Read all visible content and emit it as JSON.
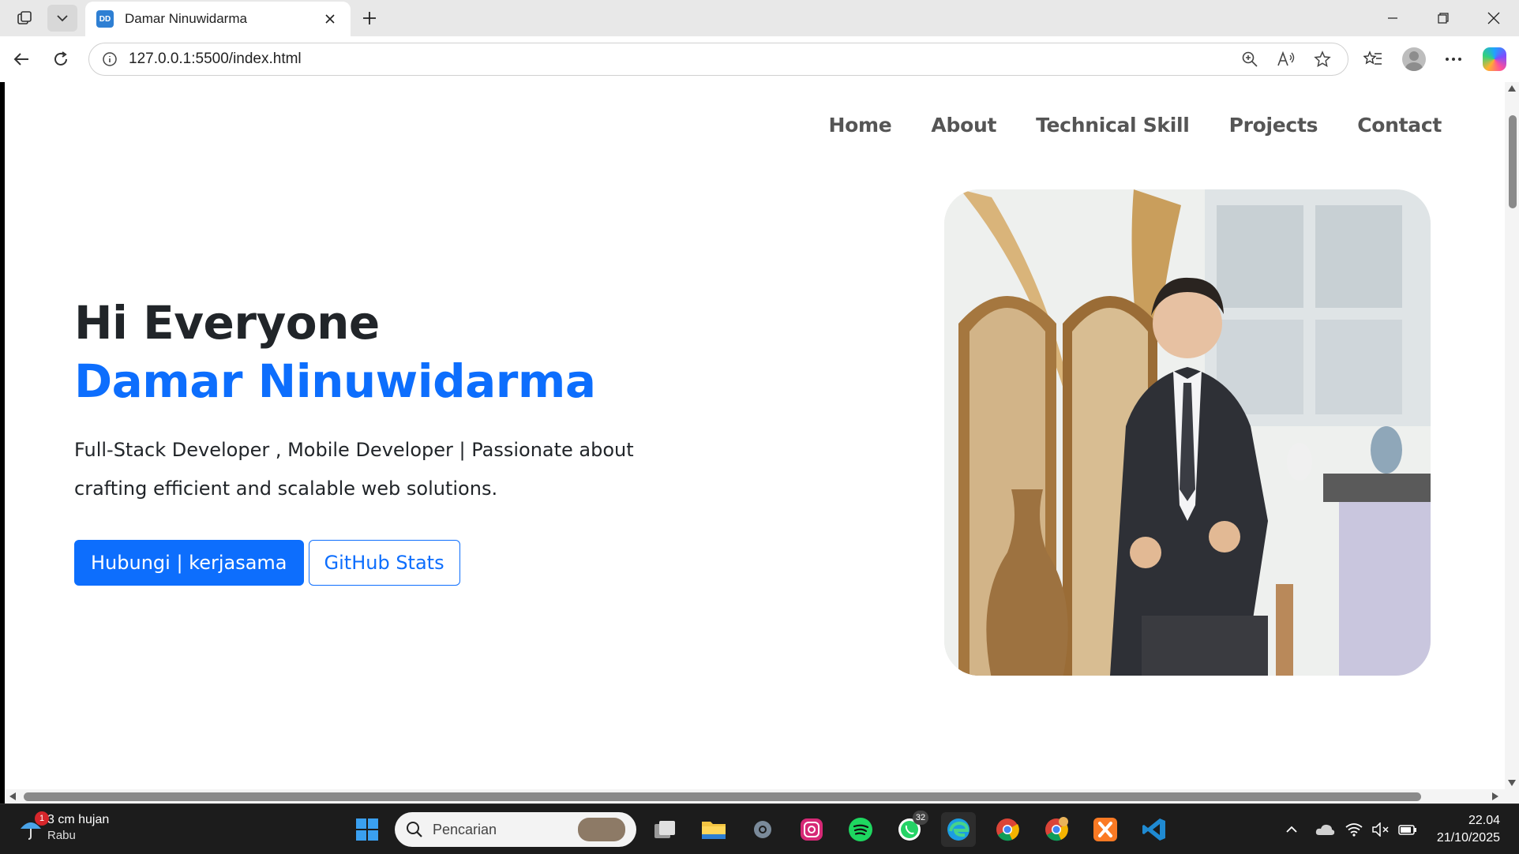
{
  "browser": {
    "tab_title": "Damar Ninuwidarma",
    "favicon_text": "DD",
    "url": "127.0.0.1:5500/index.html"
  },
  "nav": {
    "home": "Home",
    "about": "About",
    "skill": "Technical Skill",
    "projects": "Projects",
    "contact": "Contact"
  },
  "hero": {
    "greeting": "Hi Everyone",
    "name": "Damar Ninuwidarma",
    "tagline": "Full-Stack Developer , Mobile Developer | Passionate about crafting efficient and scalable web solutions.",
    "primary_button": "Hubungi | kerjasama",
    "secondary_button": "GitHub Stats"
  },
  "taskbar": {
    "weather_badge": "1",
    "weather_temp": "3 cm hujan",
    "weather_day": "Rabu",
    "search_placeholder": "Pencarian",
    "whatsapp_badge": "32",
    "time": "22.04",
    "date": "21/10/2025"
  },
  "colors": {
    "primary": "#0d6efd",
    "text_dark": "#212529",
    "nav_text": "#555555"
  }
}
